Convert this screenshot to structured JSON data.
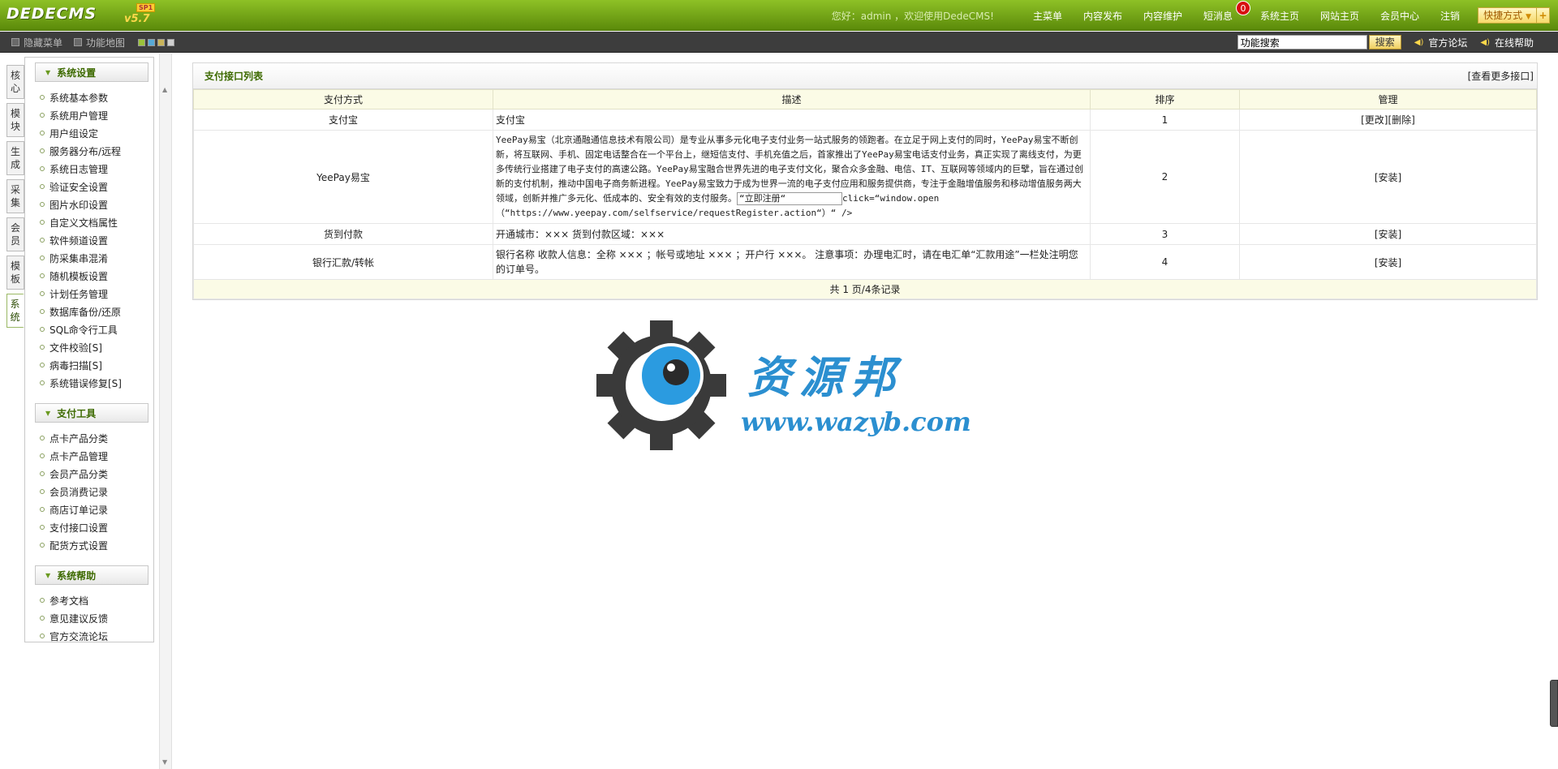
{
  "header": {
    "logo": "DEDECMS",
    "version": "v5.7",
    "tag": "SP1",
    "welcome": "您好：admin ，欢迎使用DedeCMS!",
    "nav": [
      "主菜单",
      "内容发布",
      "内容维护",
      "短消息",
      "系统主页",
      "网站主页",
      "会员中心",
      "注销"
    ],
    "message_count": "0",
    "quick_label": "快捷方式"
  },
  "subbar": {
    "hide_menu": "隐藏菜单",
    "function_map": "功能地图",
    "swatch_colors": [
      "#9bc23a",
      "#57a9d6",
      "#c9b45a",
      "#cfcfcf"
    ],
    "search_value": "功能搜索",
    "search_button": "搜索",
    "forum_link": "官方论坛",
    "help_link": "在线帮助"
  },
  "vtabs": [
    "核心",
    "模块",
    "生成",
    "采集",
    "会员",
    "模板",
    "系统"
  ],
  "menu": {
    "groups": [
      {
        "title": "系统设置",
        "items": [
          "系统基本参数",
          "系统用户管理",
          "用户组设定",
          "服务器分布/远程",
          "系统日志管理",
          "验证安全设置",
          "图片水印设置",
          "自定义文档属性",
          "软件频道设置",
          "防采集串混淆",
          "随机模板设置",
          "计划任务管理",
          "数据库备份/还原",
          "SQL命令行工具",
          "文件校验[S]",
          "病毒扫描[S]",
          "系统错误修复[S]"
        ]
      },
      {
        "title": "支付工具",
        "items": [
          "点卡产品分类",
          "点卡产品管理",
          "会员产品分类",
          "会员消费记录",
          "商店订单记录",
          "支付接口设置",
          "配货方式设置"
        ]
      },
      {
        "title": "系统帮助",
        "items": [
          "参考文档",
          "意见建议反馈",
          "官方交流论坛"
        ]
      }
    ]
  },
  "main": {
    "title": "支付接口列表",
    "more_link": "[查看更多接口]",
    "columns": [
      "支付方式",
      "描述",
      "排序",
      "管理"
    ],
    "rows": [
      {
        "method": "支付宝",
        "desc": "支付宝",
        "order": "1",
        "actions": "[更改][删除]"
      },
      {
        "method": "YeePay易宝",
        "desc": "YeePay易宝（北京通融通信息技术有限公司）是专业从事多元化电子支付业务一站式服务的领跑者。在立足于网上支付的同时，YeePay易宝不断创新，将互联网、手机、固定电话整合在一个平台上，继短信支付、手机充值之后，首家推出了YeePay易宝电话支付业务，真正实现了离线支付，为更多传统行业搭建了电子支付的高速公路。YeePay易宝融合世界先进的电子支付文化，聚合众多金融、电信、IT、互联网等领域内的巨擘，旨在通过创新的支付机制，推动中国电子商务新进程。YeePay易宝致力于成为世界一流的电子支付应用和服务提供商，专注于金融增值服务和移动增值服务两大领域，创新并推广多元化、低成本的、安全有效的支付服务。",
        "desc_box": "“立即注册“",
        "desc_tail": "click=“window.open（“https://www.yeepay.com/selfservice/requestRegister.action“）“ />",
        "order": "2",
        "actions": "[安装]"
      },
      {
        "method": "货到付款",
        "desc": "开通城市：××× 货到付款区域：×××",
        "order": "3",
        "actions": "[安装]"
      },
      {
        "method": "银行汇款/转帐",
        "desc": "银行名称 收款人信息：全称 ××× ；帐号或地址 ××× ；开户行 ×××。 注意事项：办理电汇时，请在电汇单“汇款用途”一栏处注明您的订单号。",
        "order": "4",
        "actions": "[安装]"
      }
    ],
    "footer": "共 1 页/4条记录"
  },
  "watermark": {
    "title": "资源邦",
    "url": "www.wazyb.com",
    "colors": {
      "gear": "#3a3a3a",
      "eye": "#2b9be0",
      "text": "#2b8fd0"
    }
  }
}
